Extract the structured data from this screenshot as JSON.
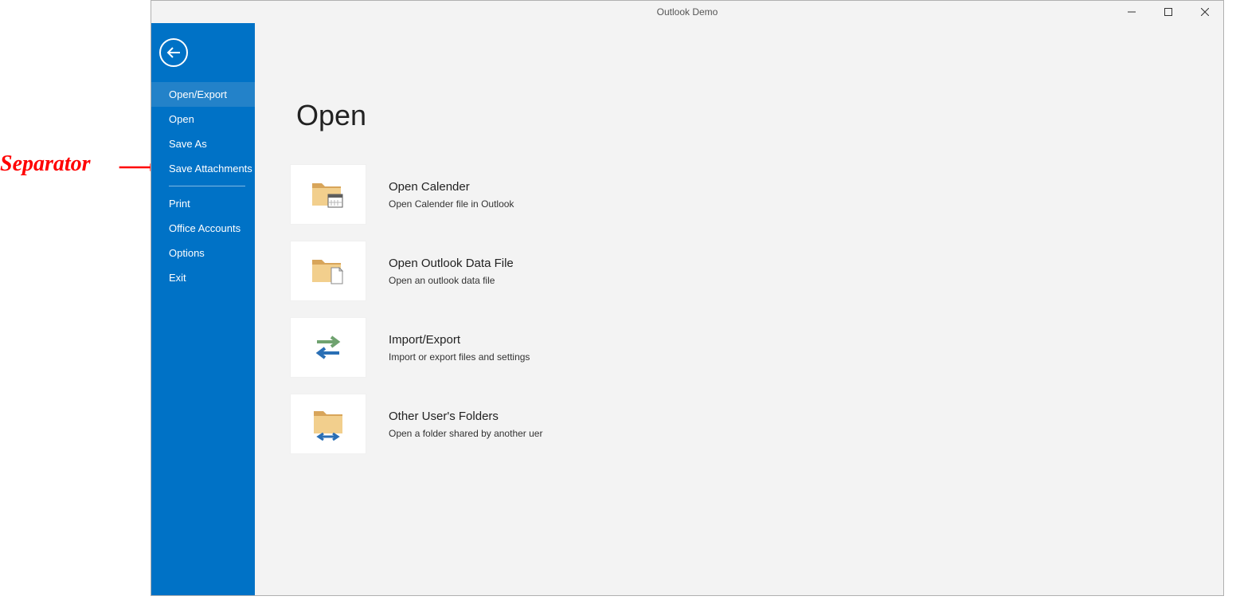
{
  "annotation": {
    "label": "Separator"
  },
  "window": {
    "title": "Outlook Demo"
  },
  "sidebar": {
    "items": [
      {
        "label": "Open/Export",
        "selected": true
      },
      {
        "label": "Open"
      },
      {
        "label": "Save As"
      },
      {
        "label": "Save Attachments"
      },
      {
        "separator": true
      },
      {
        "label": "Print"
      },
      {
        "label": "Office Accounts"
      },
      {
        "label": "Options"
      },
      {
        "label": "Exit"
      }
    ]
  },
  "main": {
    "title": "Open",
    "tiles": [
      {
        "title": "Open Calender",
        "desc": "Open Calender file in Outlook",
        "icon": "calendar-folder-icon"
      },
      {
        "title": "Open Outlook Data File",
        "desc": "Open an outlook data file",
        "icon": "data-file-folder-icon"
      },
      {
        "title": "Import/Export",
        "desc": "Import or export files and settings",
        "icon": "import-export-icon"
      },
      {
        "title": "Other User's Folders",
        "desc": "Open a folder shared by another uer",
        "icon": "shared-folder-icon"
      }
    ]
  }
}
